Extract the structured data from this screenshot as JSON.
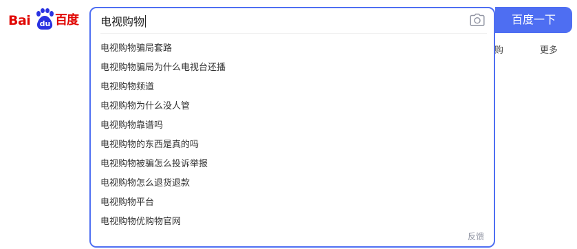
{
  "logo": {
    "text_left": "Bai",
    "paw_text": "du",
    "text_right": "百度",
    "color": "#e10602"
  },
  "search": {
    "query": "电视购物",
    "button_label": "百度一下",
    "accent_color": "#4e6ef2",
    "camera_icon": "camera-icon"
  },
  "suggestions": [
    "电视购物骗局套路",
    "电视购物骗局为什么电视台还播",
    "电视购物频道",
    "电视购物为什么没人管",
    "电视购物靠谱吗",
    "电视购物的东西是真的吗",
    "电视购物被骗怎么投诉举报",
    "电视购物怎么退货退款",
    "电视购物平台",
    "电视购物优购物官网"
  ],
  "feedback_label": "反馈",
  "nav": {
    "partial_tab": "采购",
    "more": "更多"
  }
}
